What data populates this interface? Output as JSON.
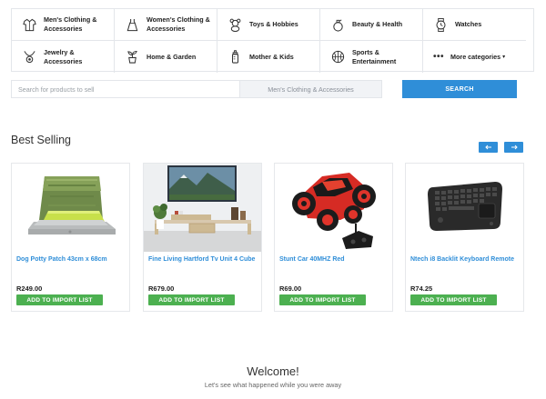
{
  "categories": [
    {
      "label": "Men's Clothing & Accessories",
      "icon": "shirt-icon"
    },
    {
      "label": "Women's Clothing & Accessories",
      "icon": "dress-icon"
    },
    {
      "label": "Toys & Hobbies",
      "icon": "teddy-bear-icon"
    },
    {
      "label": "Beauty & Health",
      "icon": "perfume-icon"
    },
    {
      "label": "Watches",
      "icon": "watch-icon"
    },
    {
      "label": "Jewelry & Accessories",
      "icon": "necklace-icon"
    },
    {
      "label": "Home & Garden",
      "icon": "plant-icon"
    },
    {
      "label": "Mother & Kids",
      "icon": "baby-bottle-icon"
    },
    {
      "label": "Sports & Entertainment",
      "icon": "basketball-icon"
    },
    {
      "label": "More categories",
      "icon": "dots-icon"
    }
  ],
  "search": {
    "placeholder": "Search for products to sell",
    "category": "Men's Clothing & Accessories",
    "button": "SEARCH"
  },
  "best_selling": {
    "title": "Best Selling",
    "prev_icon": "arrow-left-icon",
    "next_icon": "arrow-right-icon",
    "add_label": "ADD TO IMPORT LIST",
    "products": [
      {
        "name": "Dog Potty Patch 43cm x 68cm",
        "price": "R249.00"
      },
      {
        "name": "Fine Living Hartford Tv Unit 4 Cube",
        "price": "R679.00"
      },
      {
        "name": "Stunt Car 40MHZ Red",
        "price": "R69.00"
      },
      {
        "name": "Ntech i8 Backlit Keyboard Remote",
        "price": "R74.25"
      }
    ]
  },
  "welcome": {
    "title": "Welcome!",
    "subtitle": "Let's see what happened while you were away"
  },
  "colors": {
    "accent": "#2f8ed8",
    "add_button": "#4cb050",
    "product_link": "#2f8ed8"
  }
}
